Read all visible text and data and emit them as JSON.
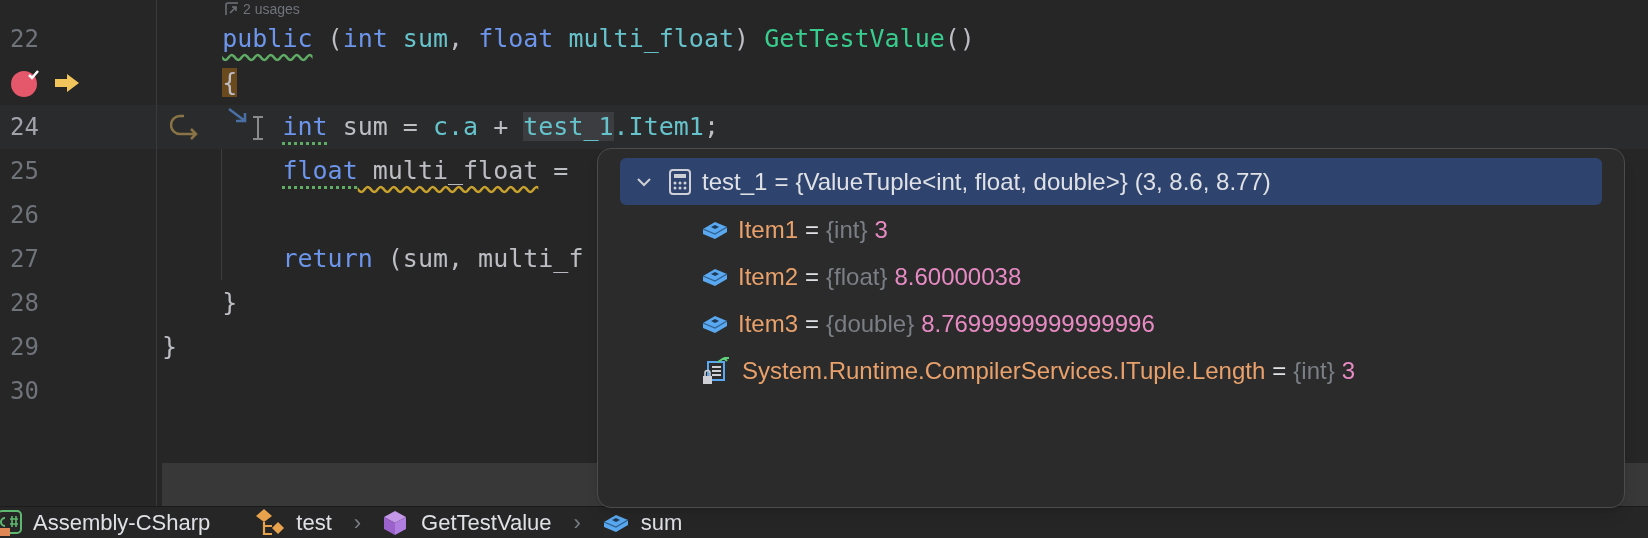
{
  "editor": {
    "usages_hint": "2 usages",
    "lines": [
      {
        "number": "22",
        "current": false,
        "breakpoint": false,
        "execution_point": false,
        "step_into": false,
        "tokens": [
          {
            "kind": "keyword",
            "text": "    public",
            "green_squiggle": true
          },
          {
            "kind": "plain",
            "text": " ("
          },
          {
            "kind": "keyword",
            "text": "int"
          },
          {
            "kind": "local",
            "text": " sum"
          },
          {
            "kind": "plain",
            "text": ", "
          },
          {
            "kind": "keyword",
            "text": "float"
          },
          {
            "kind": "local",
            "text": " multi_float"
          },
          {
            "kind": "plain",
            "text": ") "
          },
          {
            "kind": "method",
            "text": "GetTestValue"
          },
          {
            "kind": "plain",
            "text": "()"
          }
        ]
      },
      {
        "current": false,
        "breakpoint": true,
        "execution_point": true,
        "step_into": false,
        "tokens": [
          {
            "kind": "plain",
            "text": "    {",
            "brace_match": true
          }
        ]
      },
      {
        "number": "24",
        "current": true,
        "breakpoint": false,
        "execution_point": false,
        "step_into": true,
        "tokens": [
          {
            "kind": "keyword",
            "text": "        int",
            "dotted_hint": true
          },
          {
            "kind": "plain",
            "text": " sum = "
          },
          {
            "kind": "local",
            "text": "c.a"
          },
          {
            "kind": "plain",
            "text": " + "
          },
          {
            "kind": "local",
            "text": "test_1",
            "usage_highlight": true
          },
          {
            "kind": "local",
            "text": ".Item1"
          },
          {
            "kind": "plain",
            "text": ";"
          }
        ]
      },
      {
        "number": "25",
        "current": false,
        "breakpoint": false,
        "execution_point": false,
        "step_into": false,
        "tokens": [
          {
            "kind": "keyword",
            "text": "        float",
            "dotted_hint": true
          },
          {
            "kind": "plain",
            "text": " multi_float",
            "warning_squiggle": true
          },
          {
            "kind": "plain",
            "text": " ="
          }
        ]
      },
      {
        "number": "26",
        "current": false,
        "breakpoint": false,
        "execution_point": false,
        "step_into": false
      },
      {
        "number": "27",
        "current": false,
        "breakpoint": false,
        "execution_point": false,
        "step_into": false,
        "tokens": [
          {
            "kind": "keyword",
            "text": "        return"
          },
          {
            "kind": "plain",
            "text": " (sum, multi_f"
          }
        ]
      },
      {
        "number": "28",
        "current": false,
        "breakpoint": false,
        "execution_point": false,
        "step_into": false,
        "tokens": [
          {
            "kind": "plain",
            "text": "    }"
          }
        ]
      },
      {
        "number": "29",
        "current": false,
        "breakpoint": false,
        "execution_point": false,
        "step_into": false,
        "tokens": [
          {
            "kind": "plain",
            "text": "}"
          }
        ]
      },
      {
        "number": "30",
        "current": false,
        "breakpoint": false,
        "execution_point": false,
        "step_into": false
      }
    ]
  },
  "popup": {
    "rows": [
      {
        "kind": "tuple",
        "expanded": true,
        "selected": true,
        "name": "test_1",
        "equals": "=",
        "type": "{ValueTuple<int, float, double>}",
        "value": "(3, 8.6, 8.77)"
      },
      {
        "kind": "field",
        "selected": false,
        "name": "Item1",
        "equals": "=",
        "type": "{int}",
        "value": "3"
      },
      {
        "kind": "field",
        "selected": false,
        "name": "Item2",
        "equals": "=",
        "type": "{float}",
        "value": "8.60000038"
      },
      {
        "kind": "field",
        "selected": false,
        "name": "Item3",
        "equals": "=",
        "type": "{double}",
        "value": "8.7699999999999996"
      },
      {
        "kind": "property",
        "selected": false,
        "name": "System.Runtime.CompilerServices.ITuple.Length",
        "equals": "=",
        "type": "{int}",
        "value": "3"
      }
    ]
  },
  "breadcrumbs": [
    {
      "kind": "project",
      "label": "Assembly-CSharp"
    },
    {
      "kind": "class",
      "label": "test"
    },
    {
      "kind": "method",
      "separator": "›",
      "label": "GetTestValue"
    },
    {
      "kind": "field",
      "separator": "›",
      "label": "sum"
    }
  ]
}
